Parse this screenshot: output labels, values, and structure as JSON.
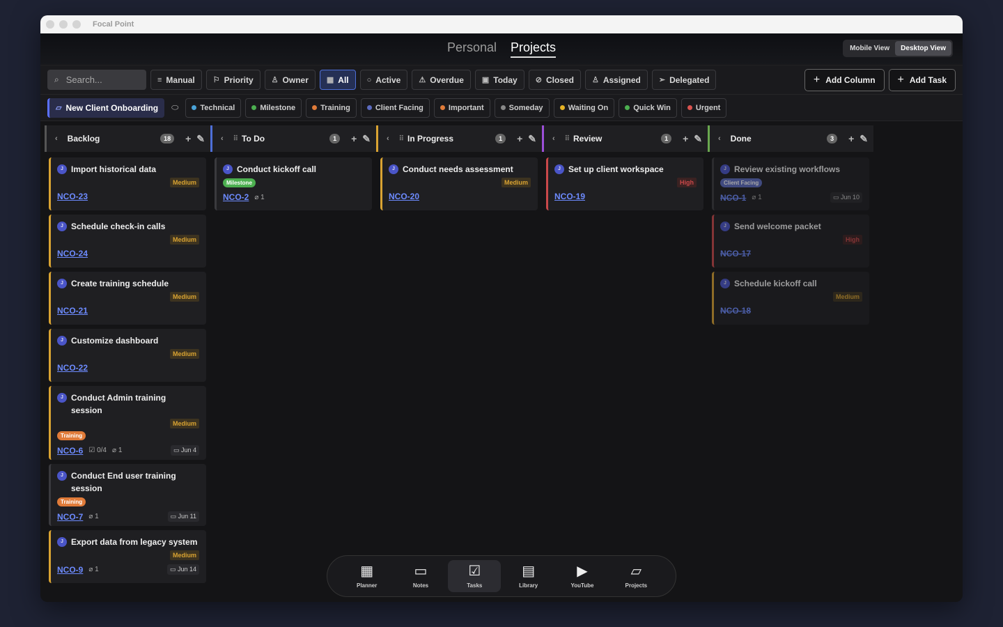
{
  "window": {
    "title": "Focal Point"
  },
  "modes": [
    {
      "label": "Personal",
      "active": false
    },
    {
      "label": "Projects",
      "active": true
    }
  ],
  "view_toggle": [
    {
      "label": "Mobile View",
      "active": false
    },
    {
      "label": "Desktop View",
      "active": true
    }
  ],
  "search": {
    "placeholder": "Search..."
  },
  "sort_buttons": [
    {
      "label": "Manual",
      "icon": "sort-icon",
      "glyph": "≡"
    },
    {
      "label": "Priority",
      "icon": "flag-icon",
      "glyph": "⚐"
    },
    {
      "label": "Owner",
      "icon": "user-icon",
      "glyph": "♙"
    }
  ],
  "status_filters": [
    {
      "label": "All",
      "icon": "grid-icon",
      "glyph": "▦",
      "active": true
    },
    {
      "label": "Active",
      "icon": "circle-icon",
      "glyph": "○",
      "active": false
    },
    {
      "label": "Overdue",
      "icon": "warning-icon",
      "glyph": "⚠",
      "active": false
    },
    {
      "label": "Today",
      "icon": "calendar-icon",
      "glyph": "▣",
      "active": false
    },
    {
      "label": "Closed",
      "icon": "check-circle-icon",
      "glyph": "⊘",
      "active": false
    },
    {
      "label": "Assigned",
      "icon": "user-icon",
      "glyph": "♙",
      "active": false
    },
    {
      "label": "Delegated",
      "icon": "send-icon",
      "glyph": "➢",
      "active": false
    }
  ],
  "actions": {
    "add_column": "Add Column",
    "add_task": "Add Task"
  },
  "project": {
    "name": "New Client Onboarding"
  },
  "labels": [
    {
      "label": "Technical",
      "color": "#4aa3d8"
    },
    {
      "label": "Milestone",
      "color": "#4caf50"
    },
    {
      "label": "Training",
      "color": "#e07b39"
    },
    {
      "label": "Client Facing",
      "color": "#5c6bc0"
    },
    {
      "label": "Important",
      "color": "#e07b39"
    },
    {
      "label": "Someday",
      "color": "#888888"
    },
    {
      "label": "Waiting On",
      "color": "#e6b325"
    },
    {
      "label": "Quick Win",
      "color": "#4caf50"
    },
    {
      "label": "Urgent",
      "color": "#d9534f"
    }
  ],
  "columns": [
    {
      "name": "Backlog",
      "count": "18",
      "color": "#555555",
      "grip": false,
      "cards": [
        {
          "title": "Import historical data",
          "priority": "Medium",
          "key": "NCO-23"
        },
        {
          "title": "Schedule check-in calls",
          "priority": "Medium",
          "key": "NCO-24"
        },
        {
          "title": "Create training schedule",
          "priority": "Medium",
          "key": "NCO-21"
        },
        {
          "title": "Customize dashboard",
          "priority": "Medium",
          "key": "NCO-22"
        },
        {
          "title": "Conduct Admin training session",
          "priority": "Medium",
          "tag": "Training",
          "tag_color": "#e07b39",
          "key": "NCO-6",
          "subtasks": "0/4",
          "attachments": "1",
          "due": "Jun 4"
        },
        {
          "title": "Conduct End user training session",
          "priority": "",
          "tag": "Training",
          "tag_color": "#e07b39",
          "key": "NCO-7",
          "attachments": "1",
          "due": "Jun 11"
        },
        {
          "title": "Export data from legacy system",
          "priority": "Medium",
          "key": "NCO-9",
          "attachments": "1",
          "due": "Jun 14"
        }
      ]
    },
    {
      "name": "To Do",
      "count": "1",
      "color": "#4e6fd8",
      "grip": true,
      "cards": [
        {
          "title": "Conduct kickoff call",
          "priority": "",
          "tag": "Milestone",
          "tag_color": "#4caf50",
          "key": "NCO-2",
          "attachments": "1"
        }
      ]
    },
    {
      "name": "In Progress",
      "count": "1",
      "color": "#d9a332",
      "grip": true,
      "cards": [
        {
          "title": "Conduct needs assessment",
          "priority": "Medium",
          "key": "NCO-20"
        }
      ]
    },
    {
      "name": "Review",
      "count": "1",
      "color": "#9c4fd8",
      "grip": true,
      "cards": [
        {
          "title": "Set up client workspace",
          "priority": "High",
          "key": "NCO-19"
        }
      ]
    },
    {
      "name": "Done",
      "count": "3",
      "color": "#6aa84f",
      "grip": false,
      "done": true,
      "cards": [
        {
          "title": "Review existing workflows",
          "priority": "",
          "tag": "Client Facing",
          "tag_color": "#5c6bc0",
          "key": "NCO-1",
          "attachments": "1",
          "due": "Jun 10"
        },
        {
          "title": "Send welcome packet",
          "priority": "High",
          "key": "NCO-17"
        },
        {
          "title": "Schedule kickoff call",
          "priority": "Medium",
          "key": "NCO-18"
        }
      ]
    }
  ],
  "dock": [
    {
      "label": "Planner",
      "icon": "calendar-icon",
      "glyph": "▦",
      "active": false
    },
    {
      "label": "Notes",
      "icon": "note-icon",
      "glyph": "▭",
      "active": false
    },
    {
      "label": "Tasks",
      "icon": "checklist-icon",
      "glyph": "☑",
      "active": true
    },
    {
      "label": "Library",
      "icon": "document-icon",
      "glyph": "▤",
      "active": false
    },
    {
      "label": "YouTube",
      "icon": "youtube-icon",
      "glyph": "▶",
      "active": false
    },
    {
      "label": "Projects",
      "icon": "folder-icon",
      "glyph": "▱",
      "active": false
    }
  ]
}
